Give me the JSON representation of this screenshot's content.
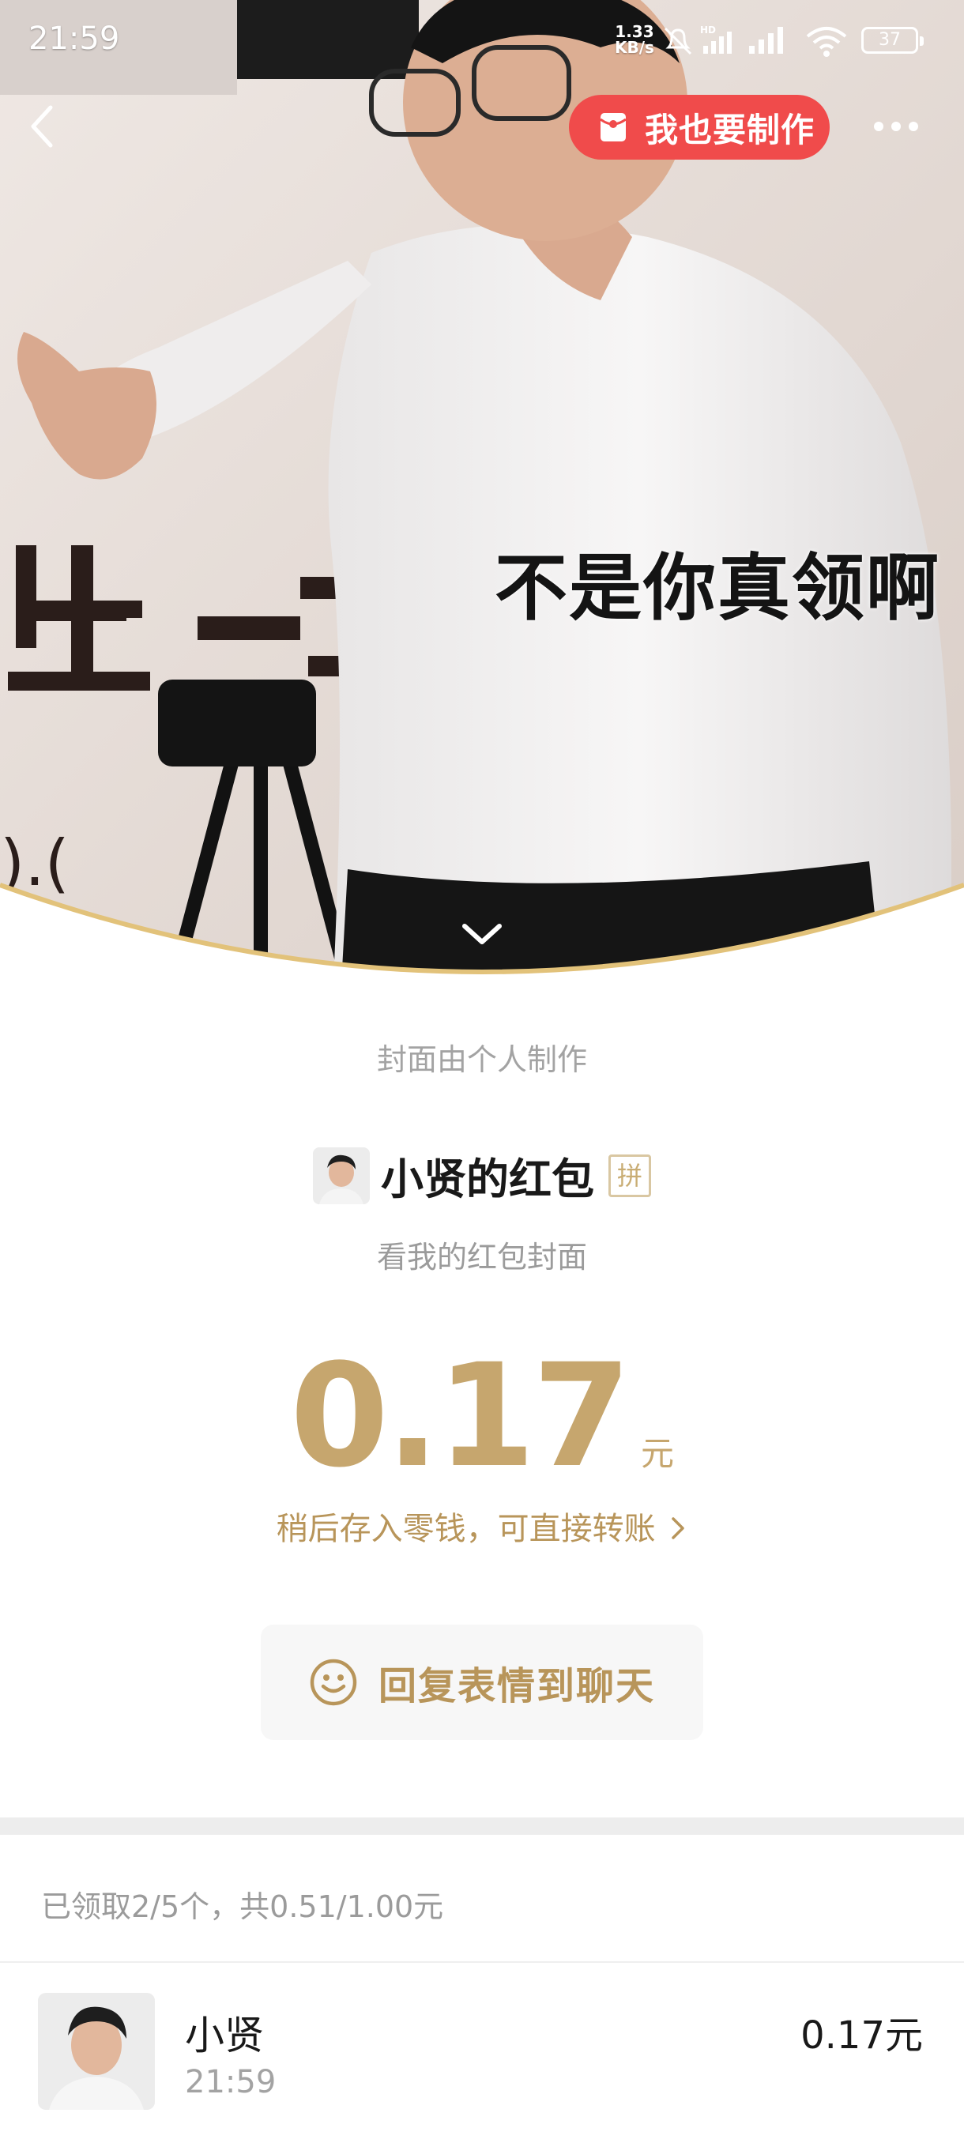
{
  "status_bar": {
    "time": "21:59",
    "net_speed_value": "1.33",
    "net_speed_unit": "KB/s",
    "battery": "37",
    "icons": [
      "mute-bell-icon",
      "hd-signal-icon",
      "signal-icon",
      "wifi-icon",
      "battery-icon"
    ]
  },
  "nav": {
    "back_icon": "chevron-left-icon",
    "make_button_label": "我也要制作",
    "make_button_icon": "red-packet-icon",
    "more_icon": "more-dots-icon"
  },
  "cover": {
    "caption": "不是你真领啊",
    "expand_icon": "chevron-down-icon",
    "note": "封面由个人制作"
  },
  "packet": {
    "sender_name": "小贤的红包",
    "badge": "拼",
    "blessing": "看我的红包封面",
    "amount": "0.17",
    "unit": "元",
    "wallet_link": "稍后存入零钱，可直接转账",
    "reply_label": "回复表情到聊天",
    "reply_icon": "smiley-icon"
  },
  "received": {
    "summary": "已领取2/5个，共0.51/1.00元",
    "items": [
      {
        "name": "小贤",
        "time": "21:59",
        "amount": "0.17元"
      }
    ]
  },
  "colors": {
    "gold": "#c6a66e",
    "gold_text": "#b8955a",
    "red_button": "#f04b4b",
    "gray_text": "#a3a3a3"
  }
}
